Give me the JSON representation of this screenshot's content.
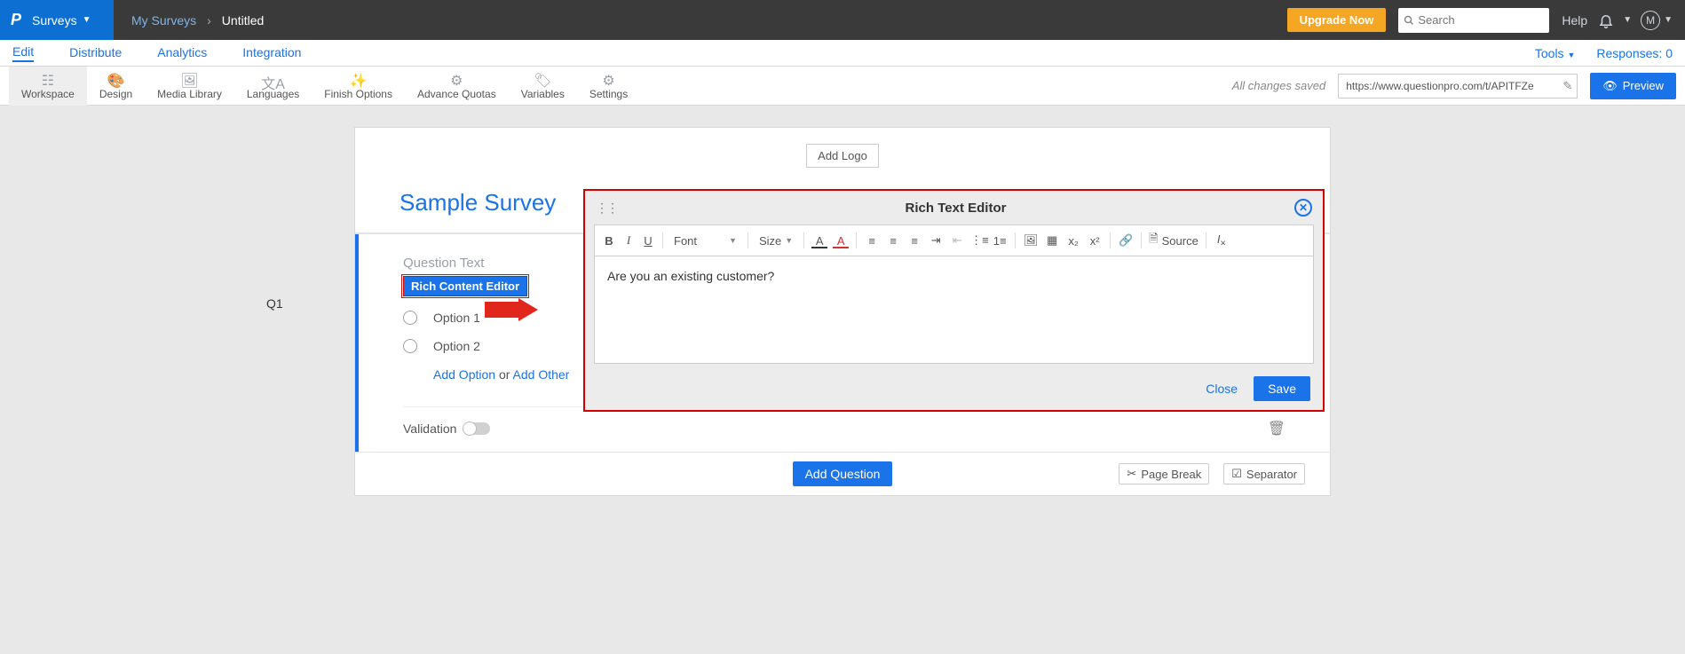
{
  "top": {
    "product": "Surveys",
    "breadcrumb_root": "My Surveys",
    "breadcrumb_current": "Untitled",
    "upgrade": "Upgrade Now",
    "search_placeholder": "Search",
    "help": "Help",
    "avatar_initial": "M"
  },
  "nav2": {
    "items": [
      "Edit",
      "Distribute",
      "Analytics",
      "Integration"
    ],
    "tools": "Tools",
    "responses_label": "Responses:",
    "responses_count": "0"
  },
  "toolbar": {
    "items": [
      "Workspace",
      "Design",
      "Media Library",
      "Languages",
      "Finish Options",
      "Advance Quotas",
      "Variables",
      "Settings"
    ],
    "saved_msg": "All changes saved",
    "url": "https://www.questionpro.com/t/APITFZe",
    "preview": "Preview"
  },
  "survey": {
    "add_logo": "Add Logo",
    "title": "Sample Survey",
    "q_number": "Q1",
    "q_label": "Question Text",
    "rce_btn": "Rich Content Editor",
    "options": [
      "Option 1",
      "Option 2"
    ],
    "add_option": "Add Option",
    "or_text": " or ",
    "add_other": "Add Other",
    "validation": "Validation",
    "add_question": "Add Question",
    "page_break": "Page Break",
    "separator": "Separator"
  },
  "rte": {
    "title": "Rich Text Editor",
    "font": "Font",
    "size": "Size",
    "source": "Source",
    "content": "Are you an existing customer?",
    "close": "Close",
    "save": "Save"
  }
}
